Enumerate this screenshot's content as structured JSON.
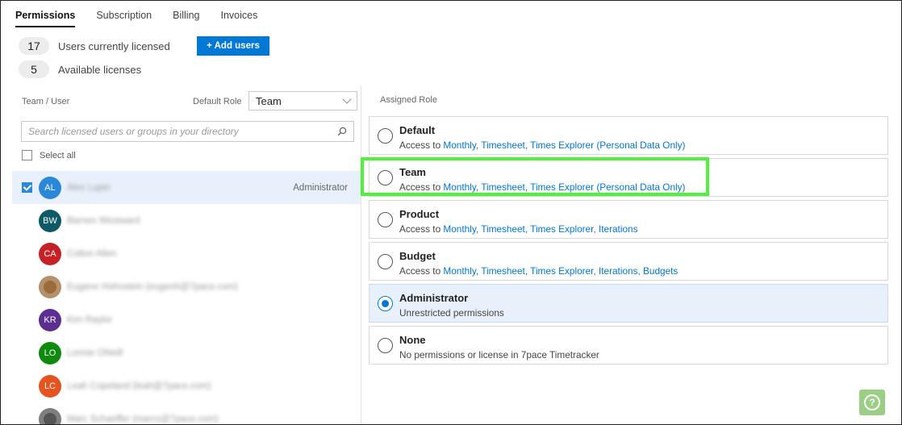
{
  "tabs": [
    {
      "label": "Permissions",
      "active": true
    },
    {
      "label": "Subscription",
      "active": false
    },
    {
      "label": "Billing",
      "active": false
    },
    {
      "label": "Invoices",
      "active": false
    }
  ],
  "licenses": {
    "licensed_count": "17",
    "licensed_label": "Users currently licensed",
    "available_count": "5",
    "available_label": "Available licenses",
    "add_users_label": "+ Add users"
  },
  "left_panel": {
    "col_header": "Team / User",
    "default_role_label": "Default Role",
    "default_role_value": "Team",
    "search_placeholder": "Search licensed users or groups in your directory",
    "select_all_label": "Select all"
  },
  "users": [
    {
      "initials": "AL",
      "name": "Alex Lupin",
      "color": "#2b88d8",
      "role": "Administrator",
      "checked": true
    },
    {
      "initials": "BW",
      "name": "Barnes Westward",
      "color": "#0e5968",
      "role": "",
      "checked": false
    },
    {
      "initials": "CA",
      "name": "Colton Allen",
      "color": "#c72127",
      "role": "",
      "checked": false
    },
    {
      "initials": "",
      "name": "Eugene Hohnstein (eugenh@7pace.com)",
      "color": "#9b6b3a",
      "role": "",
      "checked": false
    },
    {
      "initials": "KR",
      "name": "Kim Raylor",
      "color": "#5c2e91",
      "role": "",
      "checked": false
    },
    {
      "initials": "LO",
      "name": "Lonnie ONeill",
      "color": "#0f8a0f",
      "role": "",
      "checked": false
    },
    {
      "initials": "LC",
      "name": "Leah Copeland (leah@7pace.com)",
      "color": "#e5541f",
      "role": "",
      "checked": false
    },
    {
      "initials": "",
      "name": "Marc Schaeffer (marcs@7pace.com)",
      "color": "#555555",
      "role": "",
      "checked": false
    }
  ],
  "assigned_role_header": "Assigned Role",
  "roles": [
    {
      "name": "Default",
      "prefix": "Access to ",
      "links": "Monthly, Timesheet, Times Explorer (Personal Data Only)",
      "checked": false
    },
    {
      "name": "Team",
      "prefix": "Access to ",
      "links": "Monthly, Timesheet, Times Explorer (Personal Data Only)",
      "checked": false
    },
    {
      "name": "Product",
      "prefix": "Access to ",
      "links": "Monthly, Timesheet, Times Explorer, Iterations",
      "checked": false
    },
    {
      "name": "Budget",
      "prefix": "Access to ",
      "links": "Monthly, Timesheet, Times Explorer, Iterations, Budgets",
      "checked": false
    },
    {
      "name": "Administrator",
      "prefix": "Unrestricted permissions",
      "links": "",
      "checked": true
    },
    {
      "name": "None",
      "prefix": "No permissions or license in 7pace Timetracker",
      "links": "",
      "checked": false
    }
  ],
  "colors": {
    "accent": "#0078d4",
    "highlight": "#4ef23a",
    "help_button": "#9ccf86"
  },
  "icons": {
    "search": "search-icon",
    "chevron": "chevron-down-icon",
    "help": "help-icon"
  }
}
